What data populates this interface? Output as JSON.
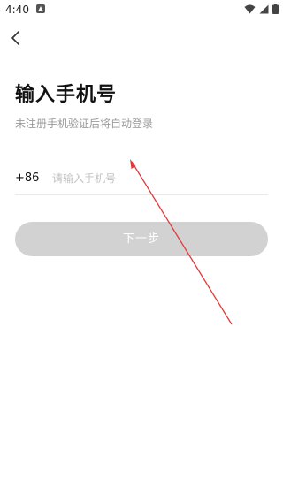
{
  "status_bar": {
    "time": "4:40",
    "icons": [
      "notification-app-icon",
      "wifi-icon",
      "signal-icon",
      "battery-icon"
    ]
  },
  "nav": {
    "back_icon": "chevron-left-icon"
  },
  "title": "输入手机号",
  "subtitle": "未注册手机验证后将自动登录",
  "phone": {
    "country_code": "+86",
    "value": "",
    "placeholder": "请输入手机号"
  },
  "next_button": {
    "label": "下一步",
    "enabled": false
  },
  "colors": {
    "button_disabled_bg": "#d2d2d2",
    "button_text": "#ffffff",
    "annotation_arrow": "#e03a3a",
    "placeholder": "#c2c2c2",
    "subtitle": "#9a9a9a"
  }
}
